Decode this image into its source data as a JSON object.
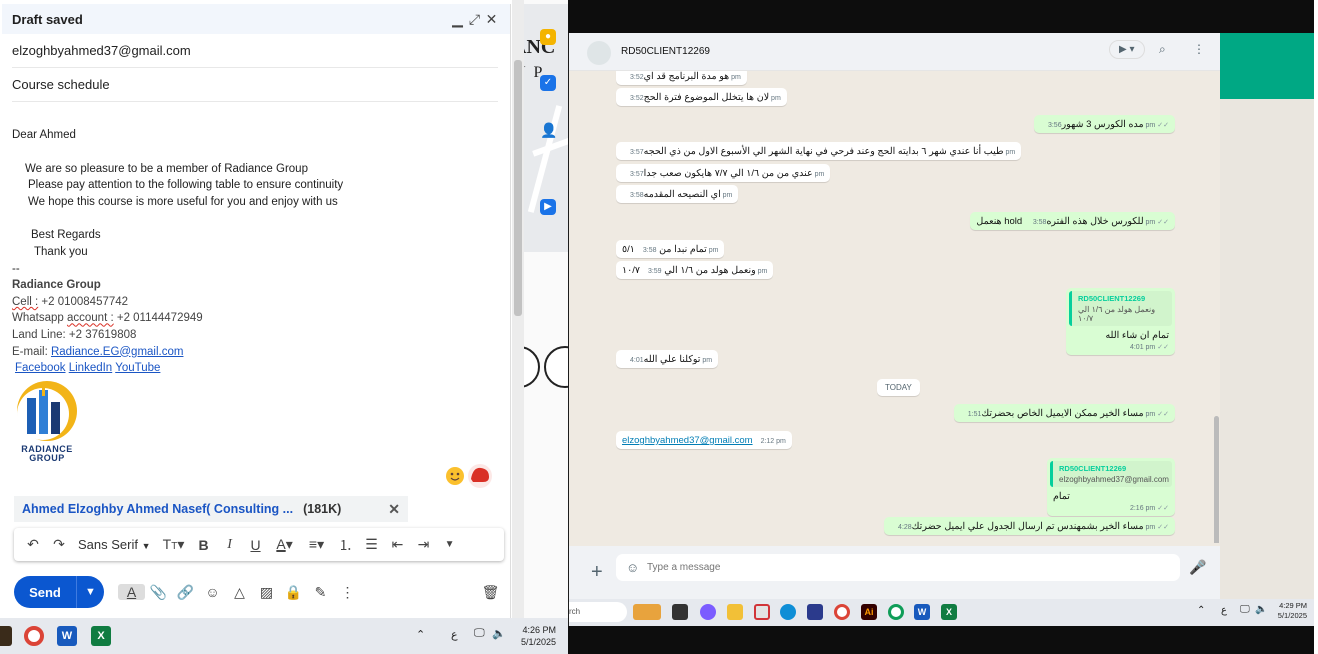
{
  "gmail": {
    "title": "Draft saved",
    "to": "elzoghbyahmed37@gmail.com",
    "subject": "Course schedule",
    "greeting": "Dear  Ahmed",
    "body_line1": "We are so pleasure to be a member of Radiance Group",
    "body_line2": "Please pay attention to the following table to ensure continuity",
    "body_line3": "We hope this course is more useful for you and enjoy with us",
    "regards": "Best Regards",
    "thanks": "Thank you",
    "sig_dash": "--",
    "sig_company": "Radiance Group",
    "sig_cell_label": "Cell :",
    "sig_cell": " +2 01008457742",
    "sig_whatsapp_label": "Whatsapp ",
    "sig_account": "account :",
    "sig_whatsapp": " +2 01144472949",
    "sig_landline": "Land Line: +2 37619808",
    "sig_email_label": "E-mail: ",
    "sig_email": "Radiance.EG@gmail.com",
    "sig_facebook": "Facebook",
    "sig_linkedin": "LinkedIn",
    "sig_youtube": "YouTube ",
    "logo_line1": "RADIANCE",
    "logo_line2": "GROUP",
    "attachment_name": "Ahmed Elzoghby Ahmed Nasef( Consulting ...",
    "attachment_size": "(181K)",
    "font_name": "Sans Serif",
    "send_label": "Send"
  },
  "left_taskbar": {
    "time": "4:26 PM",
    "date": "5/1/2025",
    "lang": "ع"
  },
  "whatsapp": {
    "contact_name": "RD50CLIENT12269",
    "messages": [
      {
        "dir": "in",
        "text": "هو مدة البرنامج قد اي",
        "time": "3:52 pm"
      },
      {
        "dir": "in",
        "text": "لان ها يتخلل الموضوع فترة الحج",
        "time": "3:52 pm"
      },
      {
        "dir": "out",
        "text": "مده الكورس 3 شهور",
        "time": "3:56 pm"
      },
      {
        "dir": "in",
        "text": "طيب أنا عندي شهر ٦ بدايته الحج وعند فرحي في نهاية الشهر الي الأسبوع الاول من ذي الحجه",
        "time": "3:57 pm"
      },
      {
        "dir": "in",
        "text": "عندي من من ١/٦ الي ٧/٧ هايكون صعب جدا",
        "time": "3:57 pm"
      },
      {
        "dir": "in",
        "text": "اي النصيحه المقدمه",
        "time": "3:58 pm"
      },
      {
        "dir": "out",
        "text": "هنعمل hold للكورس خلال هذه الفتره",
        "time": "3:58 pm"
      },
      {
        "dir": "in",
        "text": "تمام نبدا من ٥/١",
        "time": "3:58 pm"
      },
      {
        "dir": "in",
        "text": "ونعمل هولد من ١/٦ الي ١٠/٧",
        "time": "3:59 pm"
      },
      {
        "dir": "in",
        "text": "توكلنا علي الله",
        "time": "4:01 pm"
      },
      {
        "dir": "out",
        "text": "مساء الخير ممكن الايميل الخاص بحضرتك",
        "time": "1:51 pm"
      },
      {
        "dir": "in",
        "text": "elzoghbyahmed37@gmail.com",
        "time": "2:12 pm"
      },
      {
        "dir": "out",
        "text": "مساء الخير بشمهندس تم ارسال الجدول علي ايميل حضرتك",
        "time": "4:28 pm"
      }
    ],
    "quote1": {
      "author": "RD50CLIENT12269",
      "quoted": "ونعمل هولد من ١/٦ الي ١٠/٧",
      "text": "تمام ان شاء الله",
      "time": "4:01 pm"
    },
    "quote2": {
      "author": "RD50CLIENT12269",
      "quoted": "elzoghbyahmed37@gmail.com",
      "text": "تمام",
      "time": "2:16 pm"
    },
    "day_label": "TODAY",
    "input_placeholder": "Type a message"
  },
  "right_taskbar": {
    "search_text": "rch",
    "time": "4:29 PM",
    "date": "5/1/2025",
    "lang": "ع"
  },
  "colors": {
    "wa_green": "#00a884",
    "out_bubble": "#d9fdd3",
    "send_blue": "#0b57d0"
  }
}
